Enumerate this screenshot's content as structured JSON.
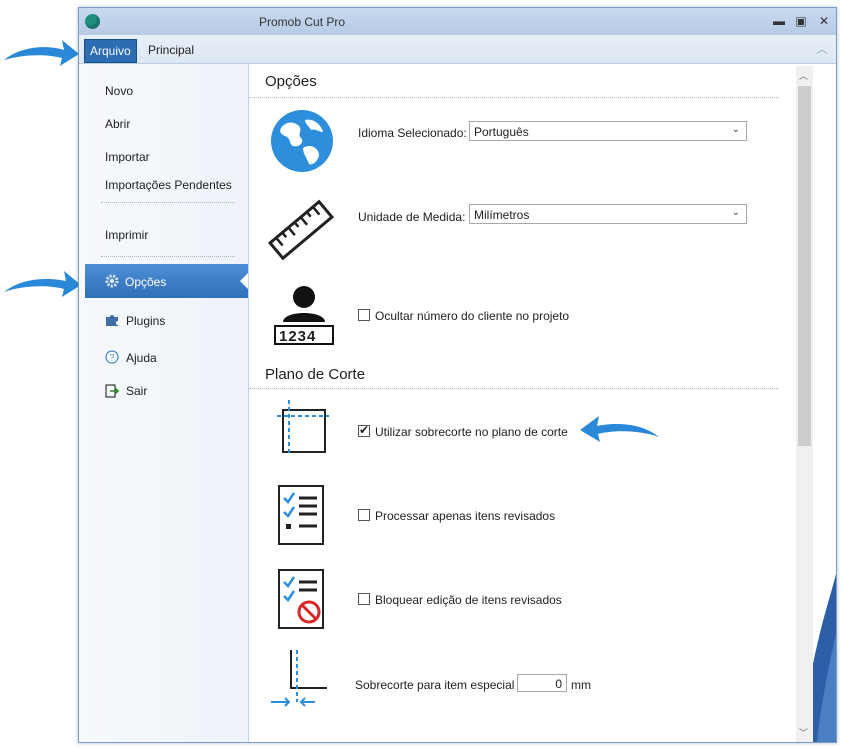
{
  "window": {
    "title": "Promob Cut Pro"
  },
  "ribbon": {
    "tabs": [
      {
        "label": "Arquivo"
      },
      {
        "label": "Principal"
      }
    ]
  },
  "sidebar": {
    "items": [
      {
        "label": "Novo"
      },
      {
        "label": "Abrir"
      },
      {
        "label": "Importar"
      },
      {
        "label": "Importações Pendentes"
      },
      {
        "label": "Imprimir"
      },
      {
        "label": "Opções",
        "icon": "gear-icon"
      },
      {
        "label": "Plugins",
        "icon": "puzzle-icon"
      },
      {
        "label": "Ajuda",
        "icon": "help-icon"
      },
      {
        "label": "Sair",
        "icon": "exit-icon"
      }
    ]
  },
  "options": {
    "title": "Opções",
    "language": {
      "label": "Idioma Selecionado:",
      "value": "Português"
    },
    "unit": {
      "label": "Unidade de Medida:",
      "value": "Milímetros"
    },
    "hide_client": {
      "label": "Ocultar número do cliente no projeto",
      "checked": false,
      "badge_number": "1234"
    }
  },
  "cut_plan": {
    "title": "Plano de Corte",
    "use_overcut": {
      "label": "Utilizar sobrecorte no plano de corte",
      "checked": true
    },
    "process_reviewed": {
      "label": "Processar apenas itens revisados",
      "checked": false
    },
    "lock_reviewed": {
      "label": "Bloquear edição de itens revisados",
      "checked": false
    },
    "special_overcut": {
      "label": "Sobrecorte para item especial",
      "value": "0",
      "unit": "mm"
    }
  },
  "colors": {
    "accent": "#2b6cb3",
    "arrow": "#2a88d8"
  }
}
